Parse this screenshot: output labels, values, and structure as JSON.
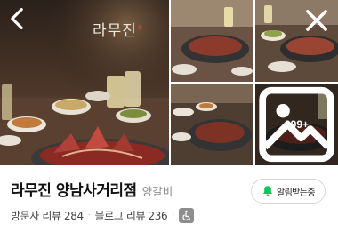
{
  "gallery": {
    "logo_text": "라무진",
    "more_count": "999+",
    "icons": {
      "back": "chevron-left-icon",
      "close": "close-icon",
      "more": "image-icon"
    }
  },
  "place": {
    "name": "라무진 양남사거리점",
    "category": "양갈비"
  },
  "notify": {
    "label": "알림받는중",
    "icon": "bell-icon",
    "accent": "#03c75a"
  },
  "stats": {
    "visitor_reviews": "방문자 리뷰 284",
    "blog_reviews": "블로그 리뷰 236",
    "accessibility_icon": "wheelchair-icon"
  },
  "colors": {
    "title": "#111111",
    "category": "#8a8a8a",
    "meta": "#444444"
  }
}
